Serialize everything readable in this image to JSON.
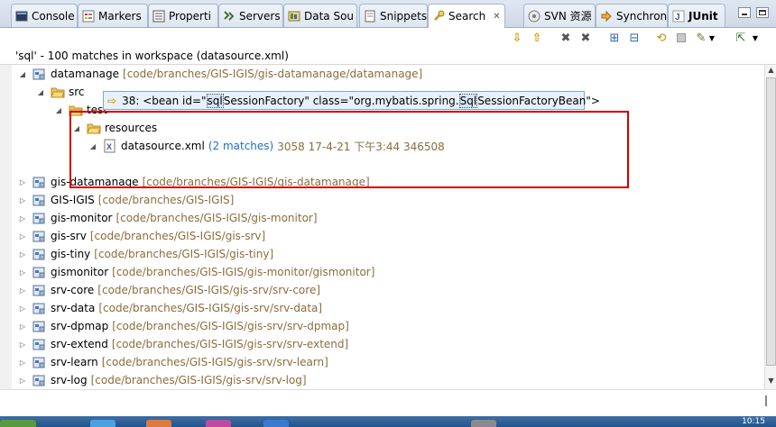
{
  "tabs": [
    {
      "label": "Console",
      "icon": "console-icon"
    },
    {
      "label": "Markers",
      "icon": "markers-icon"
    },
    {
      "label": "Properti",
      "icon": "properties-icon"
    },
    {
      "label": "Servers",
      "icon": "servers-icon"
    },
    {
      "label": "Data Sou",
      "icon": "data-source-icon"
    },
    {
      "label": "Snippets",
      "icon": "snippets-icon"
    },
    {
      "label": "Search",
      "icon": "search-icon"
    },
    {
      "label": "SVN 资源",
      "icon": "svn-icon"
    },
    {
      "label": "Synchron",
      "icon": "synchronize-icon"
    },
    {
      "label": "JUnit",
      "icon": "junit-icon"
    }
  ],
  "status": "'sql' - 100 matches in workspace (datasource.xml)",
  "tree": {
    "datamanage": {
      "name": "datamanage",
      "path": "[code/branches/GIS-IGIS/gis-datamanage/datamanage]"
    },
    "src": "src",
    "test": "test",
    "resources": "resources",
    "file": {
      "name": "datasource.xml",
      "count": "(2 matches)",
      "meta": "3058  17-4-21 下午3:44  346508"
    },
    "match": {
      "prefix": "38: <bean id=\"",
      "hl1": "sql",
      "mid": "SessionFactory\" class=\"org.mybatis.spring.",
      "hl2": "Sql",
      "suffix": "SessionFactoryBean\">"
    },
    "projects": [
      {
        "name": "gis-datamanage",
        "path": "[code/branches/GIS-IGIS/gis-datamanage]"
      },
      {
        "name": "GIS-IGIS",
        "path": "[code/branches/GIS-IGIS]"
      },
      {
        "name": "gis-monitor",
        "path": "[code/branches/GIS-IGIS/gis-monitor]"
      },
      {
        "name": "gis-srv",
        "path": "[code/branches/GIS-IGIS/gis-srv]"
      },
      {
        "name": "gis-tiny",
        "path": "[code/branches/GIS-IGIS/gis-tiny]"
      },
      {
        "name": "gismonitor",
        "path": "[code/branches/GIS-IGIS/gis-monitor/gismonitor]"
      },
      {
        "name": "srv-core",
        "path": "[code/branches/GIS-IGIS/gis-srv/srv-core]"
      },
      {
        "name": "srv-data",
        "path": "[code/branches/GIS-IGIS/gis-srv/srv-data]"
      },
      {
        "name": "srv-dpmap",
        "path": "[code/branches/GIS-IGIS/gis-srv/srv-dpmap]"
      },
      {
        "name": "srv-extend",
        "path": "[code/branches/GIS-IGIS/gis-srv/srv-extend]"
      },
      {
        "name": "srv-learn",
        "path": "[code/branches/GIS-IGIS/gis-srv/srv-learn]"
      },
      {
        "name": "srv-log",
        "path": "[code/branches/GIS-IGIS/gis-srv/srv-log]"
      }
    ]
  },
  "clock": "10:15",
  "colors": {
    "highlight_box": "#d00000",
    "path_text": "#8c6c3c",
    "match_count": "#1f6fbf"
  }
}
